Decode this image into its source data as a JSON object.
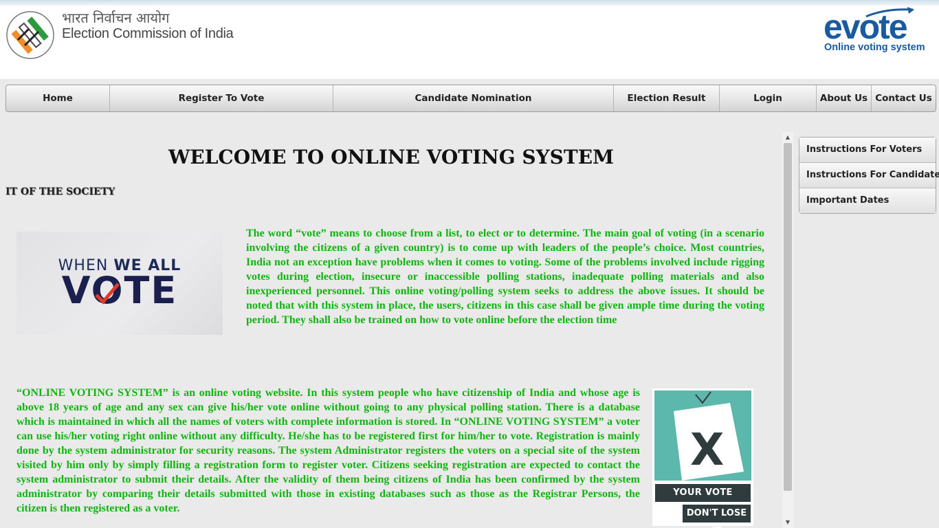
{
  "header": {
    "org_hindi": "भारत निर्वाचन आयोग",
    "org_english": "Election Commission of India",
    "logo_text": "evote",
    "logo_tagline": "Online voting system"
  },
  "nav": {
    "items": [
      "Home",
      "Register To Vote",
      "Candidate Nomination",
      "Election Result",
      "Login",
      "About Us",
      "Contact Us"
    ]
  },
  "main": {
    "welcome_title": "WELCOME TO ONLINE VOTING SYSTEM",
    "marquee_text": "IT OF THE SOCIETY",
    "image1": {
      "line1_light": "WHEN ",
      "line1_bold": "WE ALL",
      "line2": "VOTE"
    },
    "paragraph1": "The word “vote” means to choose from a list, to elect or to determine. The main goal of voting (in a scenario involving the citizens of a given country) is to come up with leaders of the people’s choice. Most countries, India not an exception have problems when it comes to voting. Some of the problems involved include rigging votes during election, insecure or inaccessible polling stations, inadequate polling materials and also inexperienced personnel. This online voting/polling system seeks to address the above issues. It should be noted that with this system in place, the users, citizens in this case shall be given ample time during the voting period. They shall also be trained on how to vote online before the election time",
    "paragraph2": "“ONLINE VOTING SYSTEM” is an online voting website. In this system people who have citizenship of India and whose age is above 18 years of age and any sex can give his/her vote online without going to any physical polling station. There is a database which is maintained in which all the names of voters with complete information is stored. In “ONLINE VOTING SYSTEM” a voter can use his/her voting right online without any difficulty. He/she has to be registered first for him/her to vote. Registration is mainly done by the system administrator for security reasons. The system Administrator registers the voters on a special site of the system visited by him only by simply filling a registration form to register voter. Citizens seeking registration are expected to contact the system administrator to submit their details. After the validity of them being citizens of India has been confirmed by the system administrator by comparing their details submitted with those in existing databases such as those as the Registrar Persons, the citizen is then registered as a voter.",
    "image2": {
      "mark": "X",
      "banner1": "YOUR VOTE MATTERS",
      "banner2": "DON'T LOSE IT"
    }
  },
  "sidebar": {
    "items": [
      "Instructions For Voters",
      "Instructions For Candidates",
      "Important Dates"
    ]
  },
  "colors": {
    "body_text_green": "#11b511",
    "evote_blue": "#1a5aa0",
    "page_bg": "#eaeaea"
  }
}
